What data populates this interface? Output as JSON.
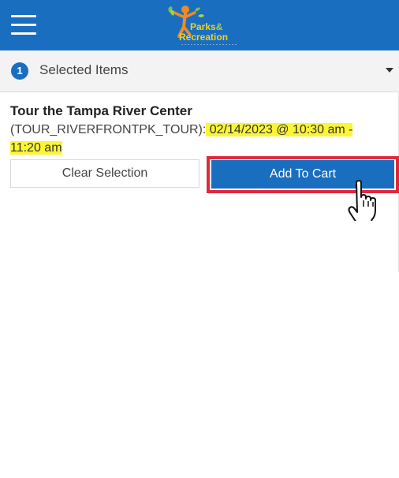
{
  "header": {
    "menu_icon": "hamburger-menu-icon",
    "logo": {
      "line1": "Parks",
      "amp": "&",
      "line2": "Recreation"
    },
    "colors": {
      "header_bg": "#1a6ec0",
      "logo_text": "#f3d11e"
    }
  },
  "selected": {
    "count": "1",
    "label": "Selected Items",
    "toggle_icon": "caret-down-icon"
  },
  "item": {
    "title": "Tour the Tampa River Center",
    "code": "(TOUR_RIVERFRONTPK_TOUR):",
    "datetime_part1": "02/14/2023 @ 10:30 am -",
    "datetime_part2": "11:20 am"
  },
  "buttons": {
    "clear": "Clear Selection",
    "add": "Add To Cart",
    "highlight_color": "#e0283d"
  },
  "cursor_icon": "hand-pointer-icon"
}
